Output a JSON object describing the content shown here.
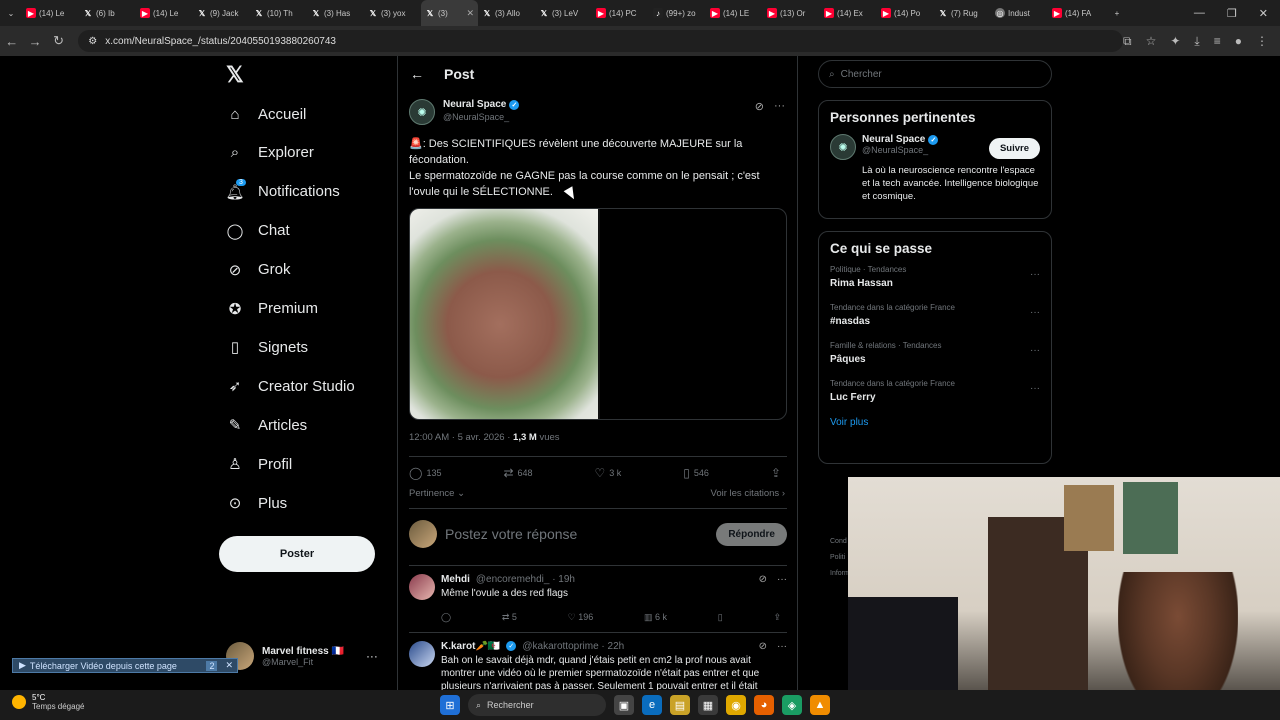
{
  "browser": {
    "tabs": [
      {
        "icon": "youtube-icon",
        "label": "(14) Le"
      },
      {
        "icon": "x-icon",
        "label": "(6) Ib"
      },
      {
        "icon": "youtube-icon",
        "label": "(14) Le"
      },
      {
        "icon": "x-icon",
        "label": "(9) Jack"
      },
      {
        "icon": "x-icon",
        "label": "(10) Th"
      },
      {
        "icon": "x-icon",
        "label": "(3) Has"
      },
      {
        "icon": "x-icon",
        "label": "(3) yox"
      },
      {
        "icon": "x-icon",
        "label": "(3)",
        "active": true
      },
      {
        "icon": "x-icon",
        "label": "(3) Allo"
      },
      {
        "icon": "x-icon",
        "label": "(3) LeV"
      },
      {
        "icon": "youtube-icon",
        "label": "(14) PC"
      },
      {
        "icon": "tiktok-icon",
        "label": "(99+) zo"
      },
      {
        "icon": "youtube-icon",
        "label": "(14) LE"
      },
      {
        "icon": "youtube-icon",
        "label": "(13) Or"
      },
      {
        "icon": "youtube-icon",
        "label": "(14) Ex"
      },
      {
        "icon": "youtube-icon",
        "label": "(14) Po"
      },
      {
        "icon": "x-icon",
        "label": "(7) Rug"
      },
      {
        "icon": "globe-icon",
        "label": "Indust"
      },
      {
        "icon": "youtube-icon",
        "label": "(14) FA"
      }
    ],
    "url": "x.com/NeuralSpace_/status/2040550193880260743"
  },
  "sidebar": {
    "items": [
      {
        "icon": "home-icon",
        "glyph": "⌂",
        "label": "Accueil"
      },
      {
        "icon": "search-icon",
        "glyph": "⌕",
        "label": "Explorer"
      },
      {
        "icon": "bell-icon",
        "glyph": "🔔︎",
        "label": "Notifications",
        "badge": "3"
      },
      {
        "icon": "chat-icon",
        "glyph": "◯",
        "label": "Chat"
      },
      {
        "icon": "grok-icon",
        "glyph": "⊘",
        "label": "Grok"
      },
      {
        "icon": "premium-icon",
        "glyph": "✪",
        "label": "Premium"
      },
      {
        "icon": "bookmark-icon",
        "glyph": "▯",
        "label": "Signets"
      },
      {
        "icon": "rocket-icon",
        "glyph": "➶",
        "label": "Creator Studio"
      },
      {
        "icon": "articles-icon",
        "glyph": "✎",
        "label": "Articles"
      },
      {
        "icon": "profile-icon",
        "glyph": "♙",
        "label": "Profil"
      },
      {
        "icon": "more-icon",
        "glyph": "⊙",
        "label": "Plus"
      }
    ],
    "post_button": "Poster",
    "profile": {
      "name": "Marvel fitness 🇫🇷",
      "handle": "@Marvel_Fit"
    },
    "download_bar": "Télécharger Vidéo depuis cette page",
    "download_count": "2"
  },
  "post": {
    "header": "Post",
    "author": {
      "name": "Neural Space",
      "handle": "@NeuralSpace_"
    },
    "text_lines": [
      "🚨: Des SCIENTIFIQUES révèlent une découverte MAJEURE sur la fécondation.",
      "Le spermatozoïde ne GAGNE pas la course comme on le pensait ; c'est l'ovule qui le SÉLECTIONNE."
    ],
    "time": "12:00 AM · 5 avr. 2026 · ",
    "views": "1,3 M",
    "views_label": " vues",
    "stats": {
      "replies": "135",
      "reposts": "648",
      "likes": "3 k",
      "bookmarks": "546"
    },
    "sort": "Pertinence",
    "quotes_link": "Voir les citations",
    "reply_placeholder": "Postez votre réponse",
    "reply_button": "Répondre"
  },
  "comments": [
    {
      "name": "Mehdi",
      "handle": "@encoremehdi_ · 19h",
      "text": "Même l'ovule a des red flags",
      "stats": {
        "reposts": "5",
        "likes": "196",
        "views": "6 k"
      }
    },
    {
      "name": "K.karot🥕🇩🇿",
      "handle": "@kakarottoprime · 22h",
      "text": "Bah on le savait déjà mdr, quand j'étais petit en cm2 la prof nous avait montrer une vidéo où le premier spermatozoïde n'était pas entrer et que plusieurs n'arrivaient pas à passer. Seulement 1 pouvait entrer et il était"
    }
  ],
  "right": {
    "search_placeholder": "Chercher",
    "relevant_title": "Personnes pertinentes",
    "relevant": {
      "name": "Neural Space",
      "handle": "@NeuralSpace_",
      "bio": "Là où la neuroscience rencontre l'espace et la tech avancée. Intelligence biologique et cosmique.",
      "follow": "Suivre"
    },
    "trends_title": "Ce qui se passe",
    "trends": [
      {
        "category": "Politique · Tendances",
        "name": "Rima Hassan"
      },
      {
        "category": "Tendance dans la catégorie France",
        "name": "#nasdas"
      },
      {
        "category": "Famille & relations · Tendances",
        "name": "Pâques"
      },
      {
        "category": "Tendance dans la catégorie France",
        "name": "Luc Ferry"
      }
    ],
    "see_more": "Voir plus",
    "footer_fragments": [
      "Cond",
      "Politi",
      "Inform"
    ]
  },
  "taskbar": {
    "temp": "5°C",
    "weather": "Temps dégagé",
    "search": "Rechercher"
  }
}
